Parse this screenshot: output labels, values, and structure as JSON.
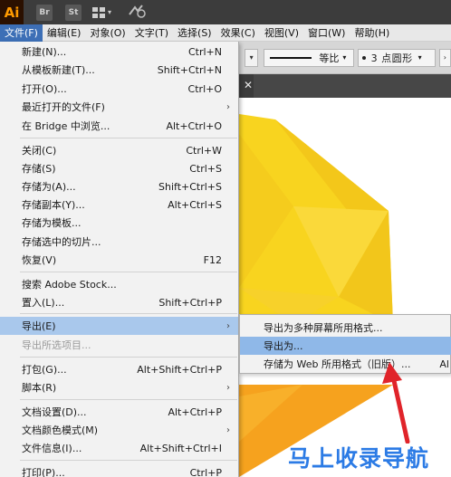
{
  "app": {
    "logo": "Ai",
    "bridge_btn": "Br",
    "stock_btn": "St"
  },
  "menubar": [
    {
      "label": "文件(F)",
      "active": true
    },
    {
      "label": "编辑(E)"
    },
    {
      "label": "对象(O)"
    },
    {
      "label": "文字(T)"
    },
    {
      "label": "选择(S)"
    },
    {
      "label": "效果(C)"
    },
    {
      "label": "视图(V)"
    },
    {
      "label": "窗口(W)"
    },
    {
      "label": "帮助(H)"
    }
  ],
  "control_bar": {
    "stroke_profile": "等比",
    "brush": "3 点圆形"
  },
  "file_menu": {
    "items": [
      {
        "label": "新建(N)...",
        "shortcut": "Ctrl+N"
      },
      {
        "label": "从模板新建(T)...",
        "shortcut": "Shift+Ctrl+N"
      },
      {
        "label": "打开(O)...",
        "shortcut": "Ctrl+O"
      },
      {
        "label": "最近打开的文件(F)",
        "shortcut": "",
        "submenu": true
      },
      {
        "label": "在 Bridge 中浏览...",
        "shortcut": "Alt+Ctrl+O"
      },
      {
        "label": "关闭(C)",
        "shortcut": "Ctrl+W"
      },
      {
        "label": "存储(S)",
        "shortcut": "Ctrl+S"
      },
      {
        "label": "存储为(A)...",
        "shortcut": "Shift+Ctrl+S"
      },
      {
        "label": "存储副本(Y)...",
        "shortcut": "Alt+Ctrl+S"
      },
      {
        "label": "存储为模板...",
        "shortcut": ""
      },
      {
        "label": "存储选中的切片...",
        "shortcut": ""
      },
      {
        "label": "恢复(V)",
        "shortcut": "F12"
      },
      {
        "label": "搜索 Adobe Stock...",
        "shortcut": ""
      },
      {
        "label": "置入(L)...",
        "shortcut": "Shift+Ctrl+P"
      },
      {
        "label": "导出(E)",
        "shortcut": "",
        "submenu": true,
        "highlighted": true
      },
      {
        "label": "导出所选项目...",
        "shortcut": "",
        "disabled": true
      },
      {
        "label": "打包(G)...",
        "shortcut": "Alt+Shift+Ctrl+P"
      },
      {
        "label": "脚本(R)",
        "shortcut": "",
        "submenu": true
      },
      {
        "label": "文档设置(D)...",
        "shortcut": "Alt+Ctrl+P"
      },
      {
        "label": "文档颜色模式(M)",
        "shortcut": "",
        "submenu": true
      },
      {
        "label": "文件信息(I)...",
        "shortcut": "Alt+Shift+Ctrl+I"
      },
      {
        "label": "打印(P)...",
        "shortcut": "Ctrl+P"
      }
    ]
  },
  "export_submenu": {
    "items": [
      {
        "label": "导出为多种屏幕所用格式...",
        "shortcut": ""
      },
      {
        "label": "导出为...",
        "shortcut": "",
        "highlighted": true
      },
      {
        "label": "存储为 Web 所用格式（旧版）...",
        "shortcut": "Al"
      }
    ]
  },
  "watermark": "马上收录导航",
  "colors": {
    "menu_highlight": "#a9c8ec",
    "submenu_highlight": "#8fb8e8",
    "active_menu": "#3d6fb6",
    "shape_yellow": "#f8d21f",
    "shape_orange": "#f6a21e",
    "arrow_red": "#e0242a"
  }
}
